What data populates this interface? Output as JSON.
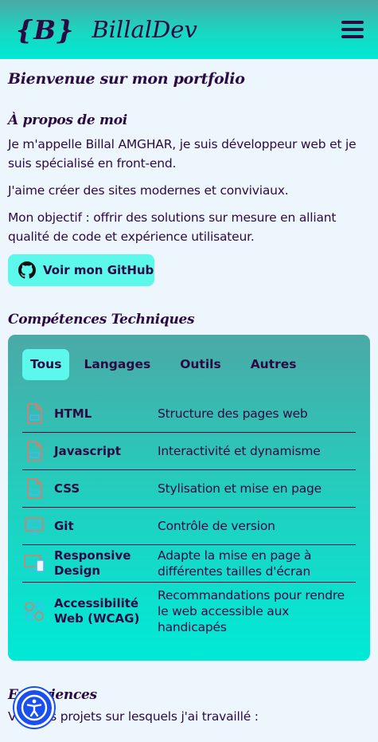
{
  "header": {
    "logo": "{B}",
    "brand": "BillalDev",
    "menu_icon": "hamburger-menu-icon"
  },
  "main": {
    "welcome": "Bienvenue sur mon portfolio",
    "about": {
      "title": "À propos de moi",
      "p1": "Je m'appelle Billal AMGHAR, je suis développeur web et je suis spécialisé en front-end.",
      "p2": "J'aime créer des sites modernes et conviviaux.",
      "p3": "Mon objectif : offrir des solutions sur mesure en alliant qualité de code et expérience utilisateur.",
      "github_button": "Voir mon GitHub"
    },
    "skills": {
      "title": "Compétences Techniques",
      "tabs": [
        "Tous",
        "Langages",
        "Outils",
        "Autres"
      ],
      "active_tab": "Tous",
      "items": [
        {
          "name": "HTML",
          "desc": "Structure des pages web",
          "icon": "html-file-icon"
        },
        {
          "name": "Javascript",
          "desc": "Interactivité et dynamisme",
          "icon": "js-file-icon"
        },
        {
          "name": "CSS",
          "desc": "Stylisation et mise en page",
          "icon": "css-file-icon"
        },
        {
          "name": "Git",
          "desc": "Contrôle de version",
          "icon": "git-monitor-icon"
        },
        {
          "name": "Responsive Design",
          "desc": "Adapte la mise en page à différentes tailles d'écran",
          "icon": "responsive-devices-icon"
        },
        {
          "name": "Accessibilité Web (WCAG)",
          "desc": "Recommandations pour rendre le web accessible aux handicapés",
          "icon": "accessibility-icon"
        }
      ]
    },
    "experiences": {
      "title": "Expériences",
      "text": "Voici les projets sur lesquels j'ai travaillé :"
    }
  },
  "colors": {
    "text": "#2b0a44",
    "accent": "#5cf8ec",
    "background": "#eef6fd",
    "a11y_button": "#1a4ff0"
  }
}
